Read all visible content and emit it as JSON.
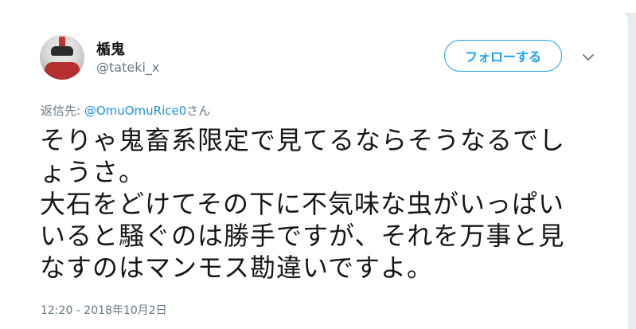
{
  "user": {
    "display_name": "楯鬼",
    "handle": "@tateki_x"
  },
  "follow_button": {
    "label": "フォローする"
  },
  "reply": {
    "prefix": "返信先: ",
    "mention": "@OmuOmuRice0",
    "suffix": "さん"
  },
  "tweet": {
    "lines": [
      "そりゃ鬼畜系限定で見てるならそうなるでし",
      "ょうさ。",
      "大石をどけてその下に不気味な虫がいっぱい",
      "いると騒ぐのは勝手ですが、それを万事と見",
      "なすのはマンモス勘違いですよ。"
    ]
  },
  "timestamp": "12:20 - 2018年10月2日",
  "colors": {
    "accent": "#1da1f2",
    "secondary_text": "#657786",
    "primary_text": "#14171a"
  }
}
